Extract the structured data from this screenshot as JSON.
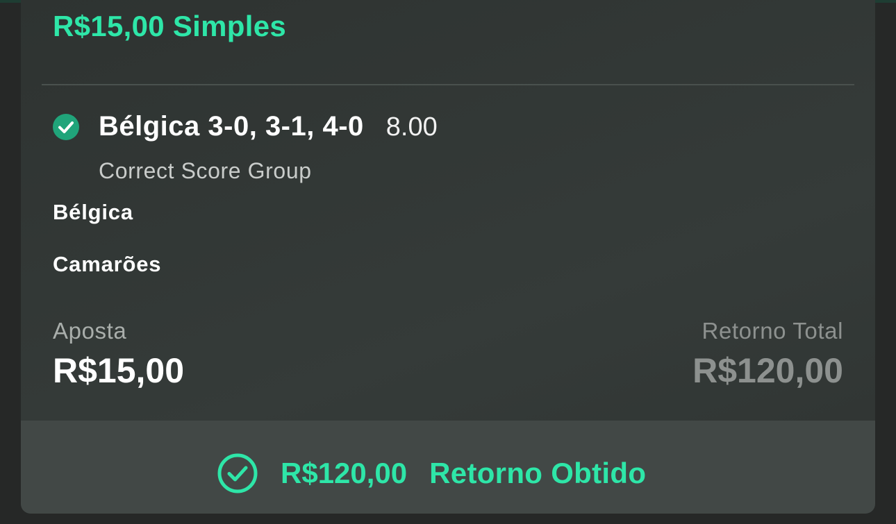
{
  "bet": {
    "header": "R$15,00 Simples",
    "status_icon": "check-circle-filled-icon",
    "selection": "Bélgica 3-0, 3-1, 4-0",
    "odds": "8.00",
    "market": "Correct Score Group",
    "teams": [
      "Bélgica",
      "Camarões"
    ],
    "stake_label": "Aposta",
    "stake_value": "R$15,00",
    "return_label": "Retorno Total",
    "return_value": "R$120,00"
  },
  "footer": {
    "icon": "check-circle-outline-icon",
    "amount": "R$120,00",
    "label": "Retorno Obtido"
  },
  "colors": {
    "accent": "#2ee6a8",
    "card_bg": "#323836",
    "footer_bg": "#424846",
    "muted_text": "#8d918f"
  }
}
